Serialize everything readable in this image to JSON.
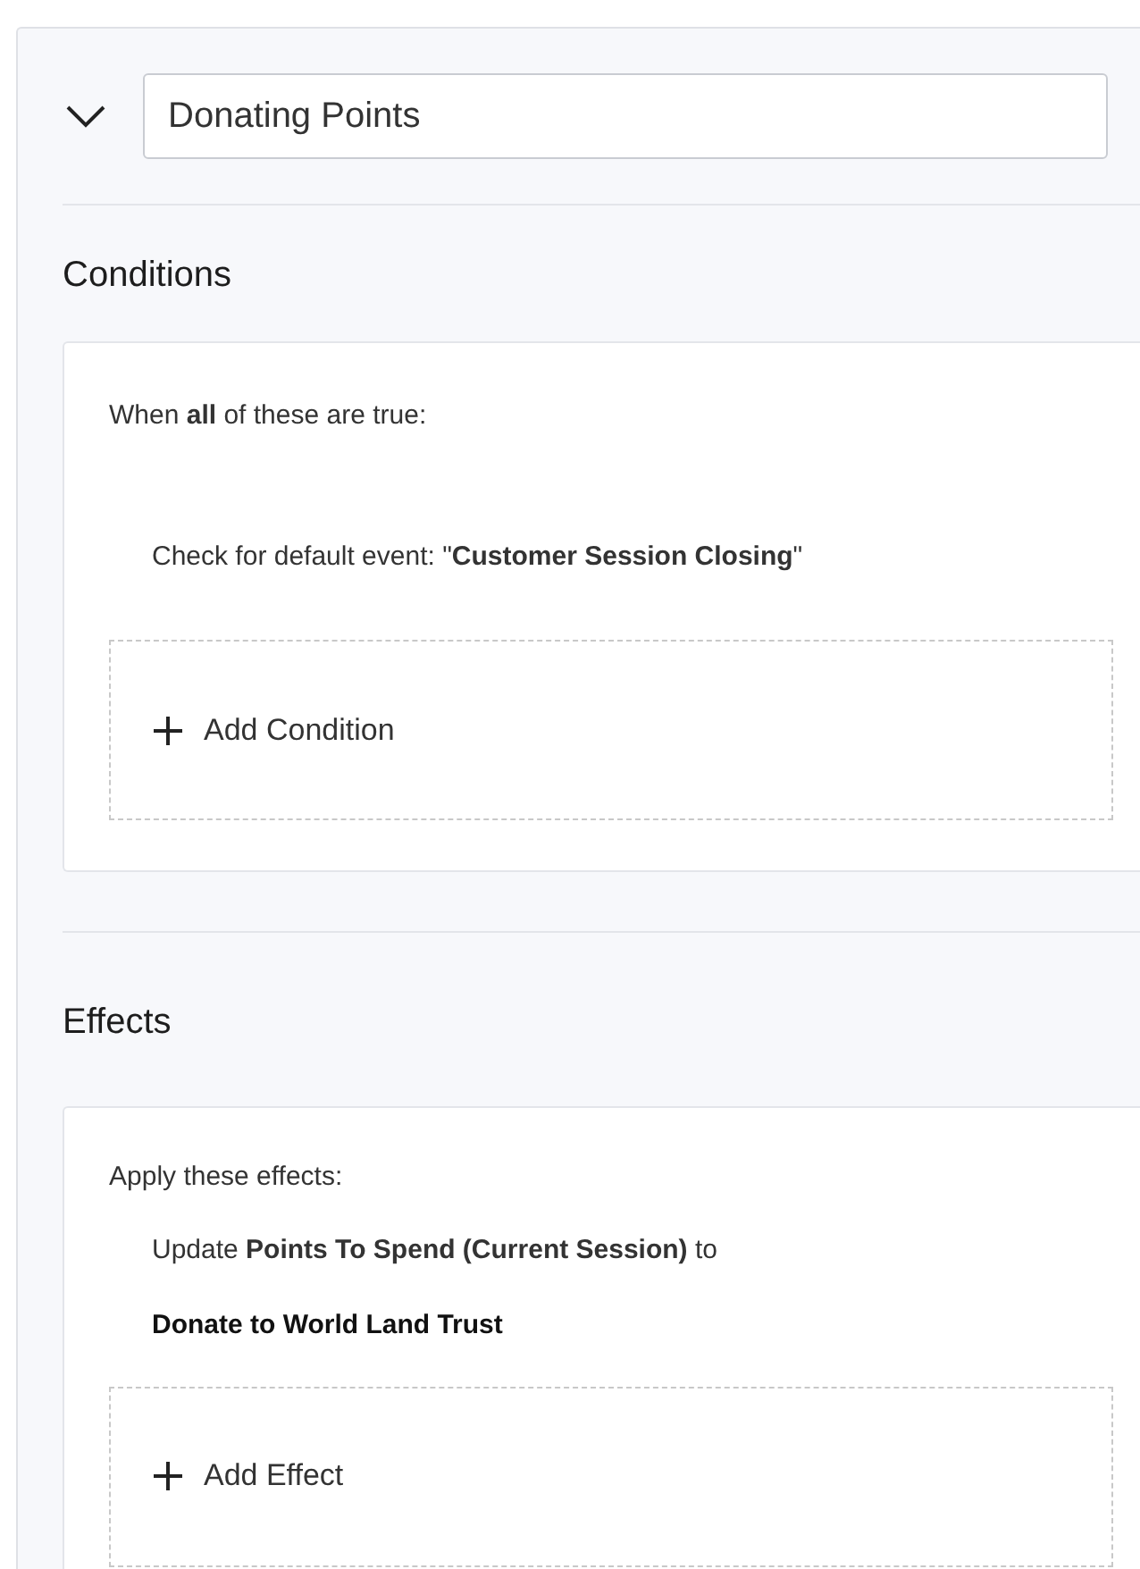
{
  "rule": {
    "expanded": true,
    "title": "Donating Points"
  },
  "conditions": {
    "heading": "Conditions",
    "intro": "When **all** of these are true:",
    "items": [
      "Check for default event: \"**Customer Session Closing**\""
    ],
    "add_button": "Add Condition"
  },
  "effects": {
    "heading": "Effects",
    "intro": "Apply these effects:",
    "items": [
      {
        "text": "Update **Points To Spend (Current Session)** to",
        "value": "Donate to World Land Trust"
      }
    ],
    "add_button": "Add Effect"
  }
}
